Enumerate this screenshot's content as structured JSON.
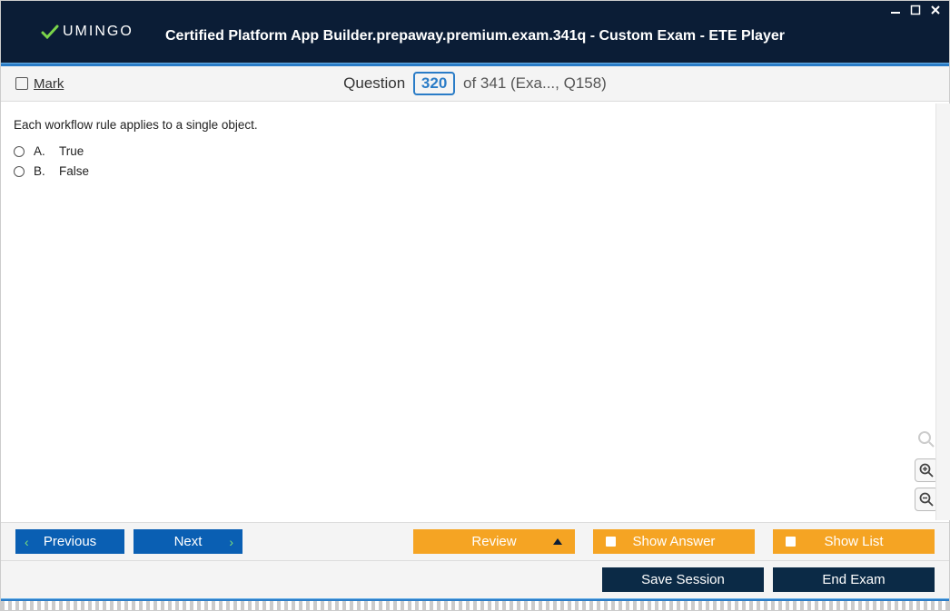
{
  "brand": "UMINGO",
  "title": "Certified Platform App Builder.prepaway.premium.exam.341q - Custom Exam - ETE Player",
  "mark_label": "Mark",
  "question_word": "Question",
  "question_number": "320",
  "question_of": "of 341 (Exa..., Q158)",
  "stem": "Each workflow rule applies to a single object.",
  "options": [
    {
      "letter": "A.",
      "text": "True"
    },
    {
      "letter": "B.",
      "text": "False"
    }
  ],
  "buttons": {
    "previous": "Previous",
    "next": "Next",
    "review": "Review",
    "show_answer": "Show Answer",
    "show_list": "Show List",
    "save_session": "Save Session",
    "end_exam": "End Exam"
  }
}
